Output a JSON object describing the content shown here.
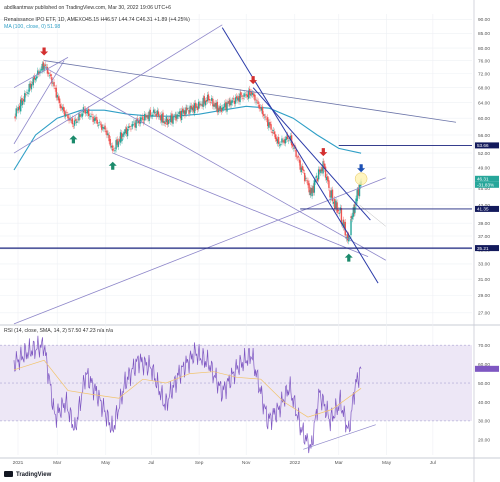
{
  "header": {
    "publisher": "abdlkantmav published on TradingView.com, Mar 30, 2022 19:06 UTC+6"
  },
  "price_legend": {
    "symbol": "Renaissance IPO ETF, 1D, AMEX",
    "ohlc": "O45.15 H46.57 L44.74 C46.31 +1.89 (+4.25%)",
    "ma": "MA (100, close, 0) 51.98"
  },
  "rsi_legend": "RSI (14, close, SMA, 14, 2) 57.50 47.23 n/a n/a",
  "footer": {
    "brand": "TradingView"
  },
  "colors": {
    "up": "#26a69a",
    "down": "#ef5350",
    "ma": "#2f9fc6",
    "trendline": "#2a3aa8",
    "fan": "#8d86c9",
    "rsi": "#7e57c2",
    "rsi_band": "#ede7f6",
    "rsi_ma": "#f2c46b",
    "tag_dark": "#131a5c",
    "arrow_up": "#1b8a6b",
    "arrow_down": "#d32f2f",
    "arrow_blue": "#1b4fb4"
  },
  "chart_data": [
    {
      "type": "candlestick",
      "title": "Renaissance IPO ETF, 1D, AMEX",
      "y_axis_ticks": [
        "90.00",
        "85.00",
        "80.00",
        "76.00",
        "72.00",
        "68.00",
        "64.00",
        "60.00",
        "56.00",
        "52.00",
        "49.00",
        "45.00",
        "42.00",
        "39.00",
        "37.00",
        "35.00",
        "33.00",
        "31.00",
        "29.00",
        "27.00"
      ],
      "ylim": [
        26,
        92
      ],
      "log_scale": true,
      "x_axis_ticks": [
        "2021",
        "Mar",
        "May",
        "Jul",
        "Sep",
        "Nov",
        "2022",
        "Mar",
        "May",
        "Jul"
      ],
      "price_tags": [
        {
          "label": "53.66",
          "value": 53.66,
          "style": "dark"
        },
        {
          "label": "46.31",
          "value": 46.31,
          "style": "green"
        },
        {
          "label": "-31.83%",
          "value": 46.31,
          "style": "green"
        },
        {
          "label": "41.35",
          "value": 41.35,
          "style": "dark"
        },
        {
          "label": "35.21",
          "value": 35.21,
          "style": "dark"
        }
      ],
      "close_series": [
        {
          "date": "2021-01-04",
          "close": 60.5
        },
        {
          "date": "2021-01-15",
          "close": 64.5
        },
        {
          "date": "2021-01-29",
          "close": 70.0
        },
        {
          "date": "2021-02-12",
          "close": 74.8
        },
        {
          "date": "2021-02-22",
          "close": 70.0
        },
        {
          "date": "2021-03-05",
          "close": 63.0
        },
        {
          "date": "2021-03-12",
          "close": 61.0
        },
        {
          "date": "2021-03-22",
          "close": 58.5
        },
        {
          "date": "2021-04-05",
          "close": 62.0
        },
        {
          "date": "2021-04-19",
          "close": 59.5
        },
        {
          "date": "2021-05-03",
          "close": 57.0
        },
        {
          "date": "2021-05-12",
          "close": 52.5
        },
        {
          "date": "2021-05-24",
          "close": 56.0
        },
        {
          "date": "2021-06-07",
          "close": 58.5
        },
        {
          "date": "2021-06-21",
          "close": 60.0
        },
        {
          "date": "2021-07-06",
          "close": 61.5
        },
        {
          "date": "2021-07-19",
          "close": 59.0
        },
        {
          "date": "2021-08-02",
          "close": 60.5
        },
        {
          "date": "2021-08-16",
          "close": 62.0
        },
        {
          "date": "2021-08-30",
          "close": 63.0
        },
        {
          "date": "2021-09-13",
          "close": 65.0
        },
        {
          "date": "2021-09-27",
          "close": 62.0
        },
        {
          "date": "2021-10-11",
          "close": 64.0
        },
        {
          "date": "2021-10-25",
          "close": 65.5
        },
        {
          "date": "2021-11-08",
          "close": 66.5
        },
        {
          "date": "2021-11-15",
          "close": 64.0
        },
        {
          "date": "2021-11-26",
          "close": 60.0
        },
        {
          "date": "2021-12-06",
          "close": 56.5
        },
        {
          "date": "2021-12-13",
          "close": 54.0
        },
        {
          "date": "2021-12-27",
          "close": 55.5
        },
        {
          "date": "2022-01-10",
          "close": 49.5
        },
        {
          "date": "2022-01-24",
          "close": 44.0
        },
        {
          "date": "2022-01-31",
          "close": 47.0
        },
        {
          "date": "2022-02-09",
          "close": 49.5
        },
        {
          "date": "2022-02-18",
          "close": 44.0
        },
        {
          "date": "2022-02-24",
          "close": 42.0
        },
        {
          "date": "2022-03-03",
          "close": 40.5
        },
        {
          "date": "2022-03-08",
          "close": 38.0
        },
        {
          "date": "2022-03-14",
          "close": 36.0
        },
        {
          "date": "2022-03-17",
          "close": 39.5
        },
        {
          "date": "2022-03-22",
          "close": 42.0
        },
        {
          "date": "2022-03-25",
          "close": 44.0
        },
        {
          "date": "2022-03-30",
          "close": 46.31
        }
      ],
      "ma100_series": [
        {
          "date": "2021-01-04",
          "value": 48.5
        },
        {
          "date": "2021-02-01",
          "value": 56.0
        },
        {
          "date": "2021-03-01",
          "value": 60.0
        },
        {
          "date": "2021-04-01",
          "value": 62.0
        },
        {
          "date": "2021-05-01",
          "value": 62.0
        },
        {
          "date": "2021-06-01",
          "value": 61.0
        },
        {
          "date": "2021-07-01",
          "value": 60.5
        },
        {
          "date": "2021-08-01",
          "value": 60.5
        },
        {
          "date": "2021-09-01",
          "value": 61.0
        },
        {
          "date": "2021-10-01",
          "value": 62.0
        },
        {
          "date": "2021-11-01",
          "value": 63.0
        },
        {
          "date": "2021-12-01",
          "value": 62.5
        },
        {
          "date": "2022-01-01",
          "value": 60.0
        },
        {
          "date": "2022-02-01",
          "value": 56.0
        },
        {
          "date": "2022-03-01",
          "value": 53.0
        },
        {
          "date": "2022-03-30",
          "value": 51.98
        }
      ],
      "markers": [
        {
          "date": "2021-02-12",
          "kind": "down"
        },
        {
          "date": "2021-03-22",
          "kind": "up"
        },
        {
          "date": "2021-05-12",
          "kind": "up"
        },
        {
          "date": "2021-11-10",
          "kind": "down"
        },
        {
          "date": "2022-02-09",
          "kind": "down"
        },
        {
          "date": "2022-03-14",
          "kind": "up"
        },
        {
          "date": "2022-03-30",
          "kind": "blue-down"
        }
      ]
    },
    {
      "type": "line",
      "title": "RSI (14, close, SMA, 14, 2)",
      "y_axis_ticks": [
        "70.00",
        "60.00",
        "50.00",
        "40.00",
        "30.00",
        "20.00"
      ],
      "ylim": [
        12,
        78
      ],
      "band": [
        30,
        70
      ],
      "rsi_series": [
        {
          "date": "2021-01-04",
          "value": 60
        },
        {
          "date": "2021-01-20",
          "value": 66
        },
        {
          "date": "2021-02-12",
          "value": 70
        },
        {
          "date": "2021-02-26",
          "value": 32
        },
        {
          "date": "2021-03-12",
          "value": 40
        },
        {
          "date": "2021-03-24",
          "value": 25
        },
        {
          "date": "2021-04-07",
          "value": 55
        },
        {
          "date": "2021-04-21",
          "value": 45
        },
        {
          "date": "2021-05-12",
          "value": 25
        },
        {
          "date": "2021-05-28",
          "value": 50
        },
        {
          "date": "2021-06-14",
          "value": 62
        },
        {
          "date": "2021-07-01",
          "value": 58
        },
        {
          "date": "2021-07-19",
          "value": 38
        },
        {
          "date": "2021-08-06",
          "value": 55
        },
        {
          "date": "2021-08-27",
          "value": 66
        },
        {
          "date": "2021-09-14",
          "value": 60
        },
        {
          "date": "2021-10-01",
          "value": 45
        },
        {
          "date": "2021-10-20",
          "value": 58
        },
        {
          "date": "2021-11-08",
          "value": 65
        },
        {
          "date": "2021-11-29",
          "value": 30
        },
        {
          "date": "2021-12-13",
          "value": 36
        },
        {
          "date": "2021-12-27",
          "value": 48
        },
        {
          "date": "2022-01-12",
          "value": 25
        },
        {
          "date": "2022-01-24",
          "value": 15
        },
        {
          "date": "2022-02-04",
          "value": 45
        },
        {
          "date": "2022-02-18",
          "value": 30
        },
        {
          "date": "2022-03-03",
          "value": 40
        },
        {
          "date": "2022-03-14",
          "value": 24
        },
        {
          "date": "2022-03-22",
          "value": 48
        },
        {
          "date": "2022-03-30",
          "value": 57.5
        }
      ],
      "rsi_ma_series": [
        {
          "date": "2021-01-04",
          "value": 57
        },
        {
          "date": "2021-02-12",
          "value": 62
        },
        {
          "date": "2021-03-15",
          "value": 46
        },
        {
          "date": "2021-04-15",
          "value": 44
        },
        {
          "date": "2021-05-20",
          "value": 42
        },
        {
          "date": "2021-06-20",
          "value": 52
        },
        {
          "date": "2021-07-20",
          "value": 50
        },
        {
          "date": "2021-08-20",
          "value": 55
        },
        {
          "date": "2021-09-20",
          "value": 56
        },
        {
          "date": "2021-10-20",
          "value": 53
        },
        {
          "date": "2021-11-20",
          "value": 52
        },
        {
          "date": "2021-12-20",
          "value": 40
        },
        {
          "date": "2022-01-20",
          "value": 32
        },
        {
          "date": "2022-02-20",
          "value": 36
        },
        {
          "date": "2022-03-30",
          "value": 47.23
        }
      ]
    }
  ]
}
